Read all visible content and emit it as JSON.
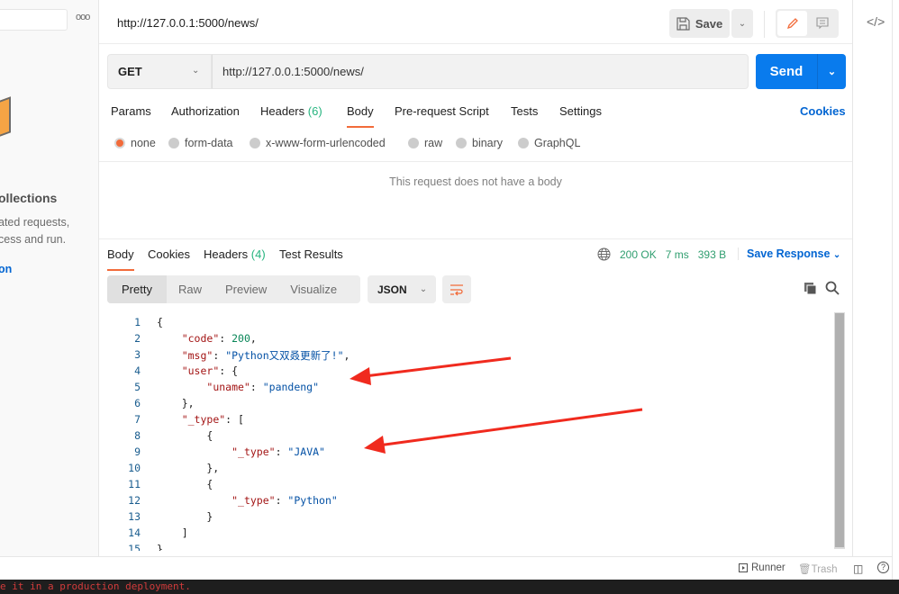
{
  "sidebar": {
    "more_label": "ooo",
    "title": "ollections",
    "description": "ated requests,\ncess and run.",
    "link": "on"
  },
  "header": {
    "tab_title": "http://127.0.0.1:5000/news/",
    "save_label": "Save"
  },
  "request": {
    "method": "GET",
    "url": "http://127.0.0.1:5000/news/",
    "send_label": "Send",
    "tabs": [
      {
        "label": "Params"
      },
      {
        "label": "Authorization"
      },
      {
        "label": "Headers",
        "count": "(6)"
      },
      {
        "label": "Body",
        "active": true
      },
      {
        "label": "Pre-request Script"
      },
      {
        "label": "Tests"
      },
      {
        "label": "Settings"
      }
    ],
    "cookies_label": "Cookies",
    "body_types": [
      {
        "label": "none",
        "selected": true
      },
      {
        "label": "form-data"
      },
      {
        "label": "x-www-form-urlencoded"
      },
      {
        "label": "raw"
      },
      {
        "label": "binary"
      },
      {
        "label": "GraphQL"
      }
    ],
    "no_body_message": "This request does not have a body"
  },
  "response": {
    "tabs": [
      {
        "label": "Body",
        "active": true
      },
      {
        "label": "Cookies"
      },
      {
        "label": "Headers",
        "count": "(4)"
      },
      {
        "label": "Test Results"
      }
    ],
    "status": "200 OK",
    "time": "7 ms",
    "size": "393 B",
    "save_response_label": "Save Response",
    "view_modes": [
      "Pretty",
      "Raw",
      "Preview",
      "Visualize"
    ],
    "active_view": "Pretty",
    "format": "JSON",
    "lines": [
      [
        [
          "{",
          "p"
        ]
      ],
      [
        [
          "    ",
          ""
        ],
        [
          "\"code\"",
          "k"
        ],
        [
          ": ",
          "p"
        ],
        [
          "200",
          "n"
        ],
        [
          ",",
          "p"
        ]
      ],
      [
        [
          "    ",
          ""
        ],
        [
          "\"msg\"",
          "k"
        ],
        [
          ": ",
          "p"
        ],
        [
          "\"Python又双叒更新了!\"",
          "s"
        ],
        [
          ",",
          "p"
        ]
      ],
      [
        [
          "    ",
          ""
        ],
        [
          "\"user\"",
          "k"
        ],
        [
          ": {",
          "p"
        ]
      ],
      [
        [
          "        ",
          ""
        ],
        [
          "\"uname\"",
          "k"
        ],
        [
          ": ",
          "p"
        ],
        [
          "\"pandeng\"",
          "s"
        ]
      ],
      [
        [
          "    },",
          ""
        ]
      ],
      [
        [
          "    ",
          ""
        ],
        [
          "\"_type\"",
          "k"
        ],
        [
          ": [",
          "p"
        ]
      ],
      [
        [
          "        {",
          ""
        ]
      ],
      [
        [
          "            ",
          ""
        ],
        [
          "\"_type\"",
          "k"
        ],
        [
          ": ",
          "p"
        ],
        [
          "\"JAVA\"",
          "s"
        ]
      ],
      [
        [
          "        },",
          ""
        ]
      ],
      [
        [
          "        {",
          ""
        ]
      ],
      [
        [
          "            ",
          ""
        ],
        [
          "\"_type\"",
          "k"
        ],
        [
          ": ",
          "p"
        ],
        [
          "\"Python\"",
          "s"
        ]
      ],
      [
        [
          "        }",
          ""
        ]
      ],
      [
        [
          "    ]",
          ""
        ]
      ],
      [
        [
          "}",
          "p"
        ]
      ]
    ]
  },
  "footer": {
    "runner_label": "Runner",
    "trash_label": "Trash",
    "help_label": "?"
  },
  "console": {
    "text": "e it in a production deployment."
  },
  "colors": {
    "accent": "#f26b3a",
    "primary": "#097bed",
    "status_ok": "#2f9e6f",
    "annotation_arrow": "#f02a1e"
  }
}
